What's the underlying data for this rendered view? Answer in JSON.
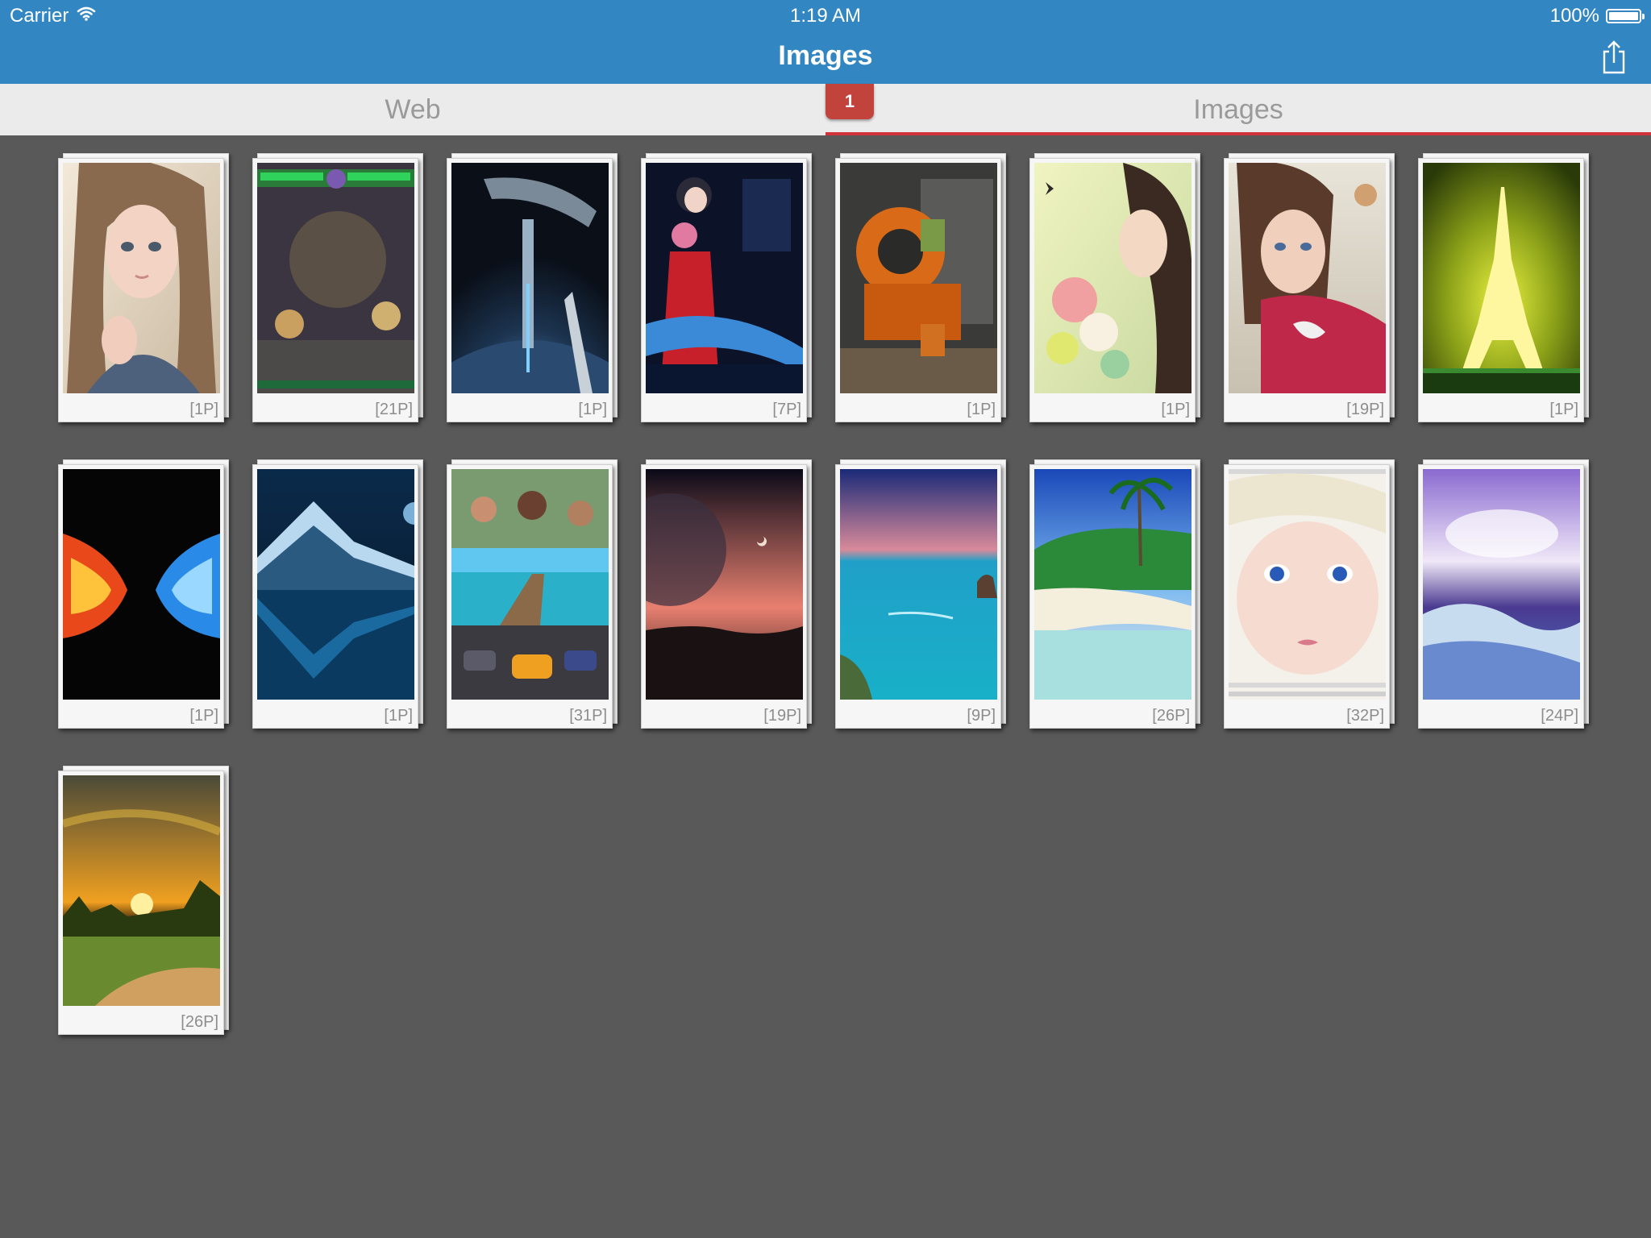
{
  "status_bar": {
    "carrier": "Carrier",
    "time": "1:19 AM",
    "battery": "100%",
    "battery_level": 1.0
  },
  "nav": {
    "title": "Images",
    "share_icon": "share-icon"
  },
  "tabs": {
    "items": [
      {
        "label": "Web",
        "selected": false
      },
      {
        "label": "Images",
        "selected": true
      }
    ],
    "badge": "1"
  },
  "colors": {
    "nav_bar": "#3287c2",
    "tab_accent": "#d0323a",
    "badge": "#c2433c",
    "background": "#595959"
  },
  "albums": [
    {
      "count": "[1P]",
      "theme": "anime-girl"
    },
    {
      "count": "[21P]",
      "theme": "fighting-game"
    },
    {
      "count": "[1P]",
      "theme": "space-station"
    },
    {
      "count": "[7P]",
      "theme": "anime-poster"
    },
    {
      "count": "[1P]",
      "theme": "orange-robot"
    },
    {
      "count": "[1P]",
      "theme": "flower-girl"
    },
    {
      "count": "[19P]",
      "theme": "kimono-girl"
    },
    {
      "count": "[1P]",
      "theme": "eiffel-tower"
    },
    {
      "count": "[1P]",
      "theme": "fire-ice"
    },
    {
      "count": "[1P]",
      "theme": "blue-mountain"
    },
    {
      "count": "[31P]",
      "theme": "collage"
    },
    {
      "count": "[19P]",
      "theme": "planet-sunset"
    },
    {
      "count": "[9P]",
      "theme": "blue-sea"
    },
    {
      "count": "[26P]",
      "theme": "tropical-beach"
    },
    {
      "count": "[32P]",
      "theme": "baby-face"
    },
    {
      "count": "[24P]",
      "theme": "purple-sky"
    },
    {
      "count": "[26P]",
      "theme": "field-sunset"
    }
  ]
}
